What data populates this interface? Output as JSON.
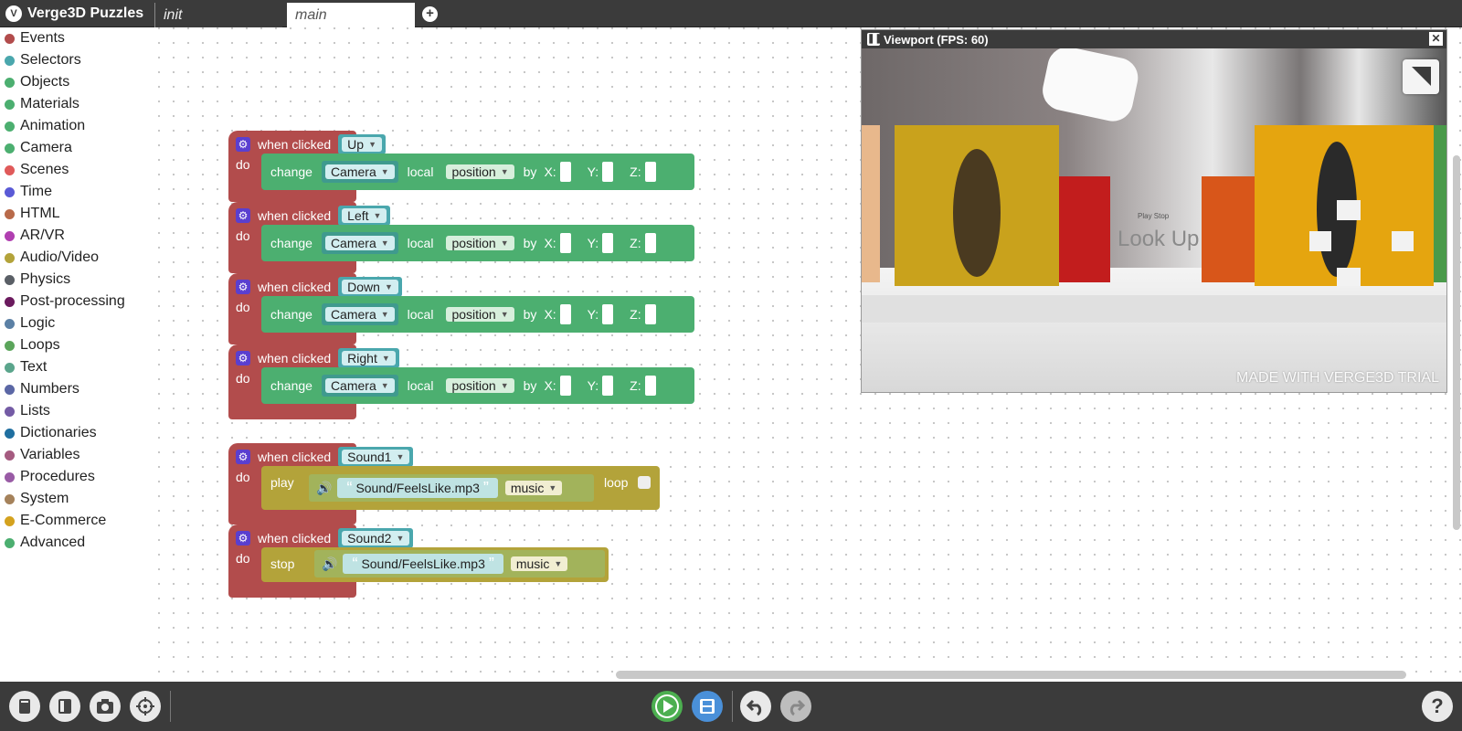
{
  "app": {
    "title": "Verge3D Puzzles",
    "logo_glyph": "V"
  },
  "tabs": [
    {
      "label": "init"
    },
    {
      "label": "main"
    }
  ],
  "add_tab_glyph": "+",
  "categories": [
    {
      "label": "Events",
      "color": "#b24c4c"
    },
    {
      "label": "Selectors",
      "color": "#4aa7ad"
    },
    {
      "label": "Objects",
      "color": "#4caf70"
    },
    {
      "label": "Materials",
      "color": "#4caf70"
    },
    {
      "label": "Animation",
      "color": "#4caf70"
    },
    {
      "label": "Camera",
      "color": "#4caf70"
    },
    {
      "label": "Scenes",
      "color": "#e05a5a"
    },
    {
      "label": "Time",
      "color": "#5a5ad6"
    },
    {
      "label": "HTML",
      "color": "#b86a4a"
    },
    {
      "label": "AR/VR",
      "color": "#b03fb0"
    },
    {
      "label": "Audio/Video",
      "color": "#b3a33a"
    },
    {
      "label": "Physics",
      "color": "#5a5f66"
    },
    {
      "label": "Post-processing",
      "color": "#6b1a5e"
    },
    {
      "label": "Logic",
      "color": "#5b80a5"
    },
    {
      "label": "Loops",
      "color": "#5ba55b"
    },
    {
      "label": "Text",
      "color": "#5ba58c"
    },
    {
      "label": "Numbers",
      "color": "#5b67a5"
    },
    {
      "label": "Lists",
      "color": "#745ba5"
    },
    {
      "label": "Dictionaries",
      "color": "#1f6fa0"
    },
    {
      "label": "Variables",
      "color": "#a55b80"
    },
    {
      "label": "Procedures",
      "color": "#995ba5"
    },
    {
      "label": "System",
      "color": "#a5825b"
    },
    {
      "label": "E-Commerce",
      "color": "#d4a21f"
    },
    {
      "label": "Advanced",
      "color": "#4caf70"
    }
  ],
  "puzzles": {
    "when_clicked": "when clicked",
    "do": "do",
    "change": "change",
    "local": "local",
    "by": "by",
    "x": "X:",
    "y": "Y:",
    "z": "Z:",
    "play": "play",
    "stop": "stop",
    "loop": "loop",
    "quote_open": "“",
    "quote_close": "”",
    "move_blocks": [
      {
        "target": "Up",
        "object": "Camera",
        "param": "position"
      },
      {
        "target": "Left",
        "object": "Camera",
        "param": "position"
      },
      {
        "target": "Down",
        "object": "Camera",
        "param": "position"
      },
      {
        "target": "Right",
        "object": "Camera",
        "param": "position"
      }
    ],
    "sound_blocks": [
      {
        "target": "Sound1",
        "file": "Sound/FeelsLike.mp3",
        "type": "music"
      },
      {
        "target": "Sound2",
        "file": "Sound/FeelsLike.mp3",
        "type": "music"
      }
    ]
  },
  "viewport": {
    "title": "Viewport (FPS: 60)",
    "watermark": "MADE WITH VERGE3D TRIAL",
    "scene_text": "Look Up",
    "scene_buttons": "Play  Stop"
  },
  "bottom_buttons": [
    {
      "name": "manual-icon"
    },
    {
      "name": "toggle-panel-icon"
    },
    {
      "name": "screenshot-icon"
    },
    {
      "name": "target-icon"
    },
    {
      "name": "run-icon"
    },
    {
      "name": "save-icon"
    },
    {
      "name": "undo-icon"
    },
    {
      "name": "redo-icon"
    },
    {
      "name": "help-icon"
    }
  ],
  "help_glyph": "?"
}
